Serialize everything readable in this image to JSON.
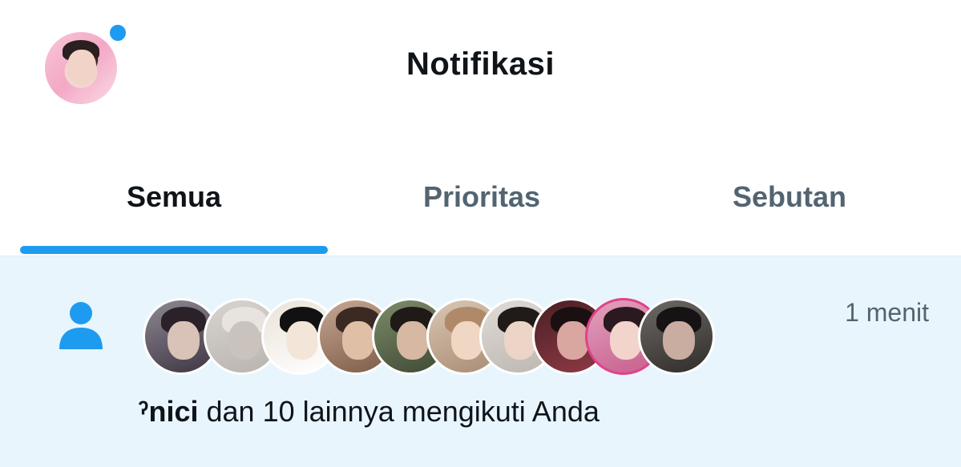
{
  "header": {
    "title": "Notifikasi",
    "avatar_icon": "profile-avatar",
    "has_new_indicator": true
  },
  "tabs": [
    {
      "label": "Semua",
      "active": true
    },
    {
      "label": "Prioritas",
      "active": false
    },
    {
      "label": "Sebutan",
      "active": false
    }
  ],
  "colors": {
    "accent": "#1d9bf0",
    "unread_background": "#e8f5fd",
    "text_primary": "#0f1419",
    "text_secondary": "#536471"
  },
  "notification": {
    "icon": "person-icon",
    "time": "1 menit",
    "name": "ˀnici",
    "text": " dan 10 lainnya mengikuti Anda",
    "follower_avatar_count": 10
  }
}
